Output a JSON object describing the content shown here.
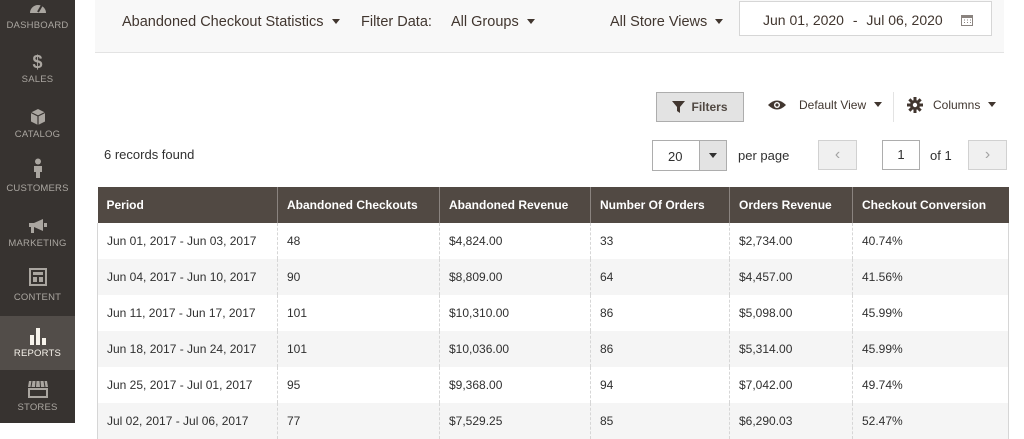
{
  "sidebar": {
    "items": [
      {
        "label": "DASHBOARD",
        "icon": "dashboard-icon"
      },
      {
        "label": "SALES",
        "icon": "dollar-icon"
      },
      {
        "label": "CATALOG",
        "icon": "box-icon"
      },
      {
        "label": "CUSTOMERS",
        "icon": "person-icon"
      },
      {
        "label": "MARKETING",
        "icon": "megaphone-icon"
      },
      {
        "label": "CONTENT",
        "icon": "layout-icon"
      },
      {
        "label": "REPORTS",
        "icon": "bar-chart-icon",
        "active": true
      },
      {
        "label": "STORES",
        "icon": "store-icon"
      }
    ]
  },
  "topbar": {
    "report_select": "Abandoned Checkout Statistics",
    "filter_label": "Filter Data:",
    "group_select": "All Groups",
    "store_select": "All Store Views",
    "date_from": "Jun 01, 2020",
    "date_sep": "-",
    "date_to": "Jul 06, 2020"
  },
  "toolbar": {
    "filters_label": "Filters",
    "view_label": "Default View",
    "columns_label": "Columns"
  },
  "grid": {
    "records_text": "6 records found",
    "per_page_value": "20",
    "per_page_label": "per page",
    "page_value": "1",
    "page_of": "of 1",
    "columns": [
      "Period",
      "Abandoned Checkouts",
      "Abandoned Revenue",
      "Number Of Orders",
      "Orders Revenue",
      "Checkout Conversion"
    ],
    "rows": [
      [
        "Jun 01, 2017 - Jun 03, 2017",
        "48",
        "$4,824.00",
        "33",
        "$2,734.00",
        "40.74%"
      ],
      [
        "Jun 04, 2017 - Jun 10, 2017",
        "90",
        "$8,809.00",
        "64",
        "$4,457.00",
        "41.56%"
      ],
      [
        "Jun 11, 2017 - Jun 17, 2017",
        "101",
        "$10,310.00",
        "86",
        "$5,098.00",
        "45.99%"
      ],
      [
        "Jun 18, 2017 - Jun 24, 2017",
        "101",
        "$10,036.00",
        "86",
        "$5,314.00",
        "45.99%"
      ],
      [
        "Jun 25, 2017 - Jul 01, 2017",
        "95",
        "$9,368.00",
        "94",
        "$7,042.00",
        "49.74%"
      ],
      [
        "Jul 02, 2017 - Jul 06, 2017",
        "77",
        "$7,529.25",
        "85",
        "$6,290.03",
        "52.47%"
      ]
    ]
  },
  "colors": {
    "sidebar_bg": "#373330",
    "sidebar_active": "#524d49",
    "table_header": "#514943"
  }
}
